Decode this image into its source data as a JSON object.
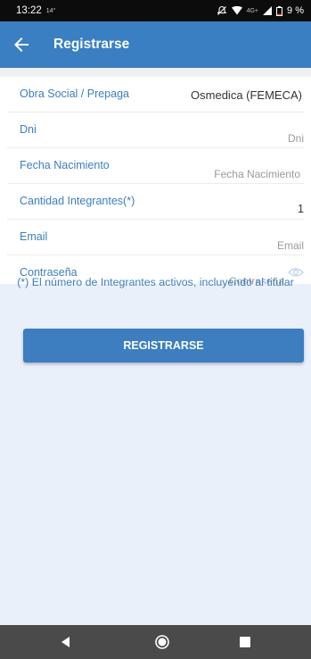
{
  "status_bar": {
    "time": "13:22",
    "small_text": "14°",
    "network": "4G+",
    "battery": "9 %"
  },
  "app_bar": {
    "title": "Registrarse",
    "back_icon": "arrow-left-icon"
  },
  "form": {
    "obra_social": {
      "label": "Obra Social / Prepaga",
      "value": "Osmedica (FEMECA)"
    },
    "dni": {
      "label": "Dni",
      "placeholder": "Dni"
    },
    "fecha": {
      "label": "Fecha Nacimiento",
      "placeholder": "Fecha Nacimiento"
    },
    "cantidad": {
      "label": "Cantidad Integrantes(*)",
      "value": "1"
    },
    "email": {
      "label": "Email",
      "placeholder": "Email"
    },
    "password": {
      "label": "Contraseña",
      "placeholder": "Contraseña",
      "icon": "eye-icon"
    }
  },
  "note": "(*) El número de Integrantes activos, incluyendo al titular",
  "submit_label": "REGISTRARSE",
  "colors": {
    "primary": "#3a7fc1",
    "status_bar": "#0c0c0c",
    "nav_bar": "#4a4a4a",
    "lower_background": "#eaf0fa"
  },
  "nav_icons": [
    "back-triangle-icon",
    "home-circle-icon",
    "recents-square-icon"
  ]
}
